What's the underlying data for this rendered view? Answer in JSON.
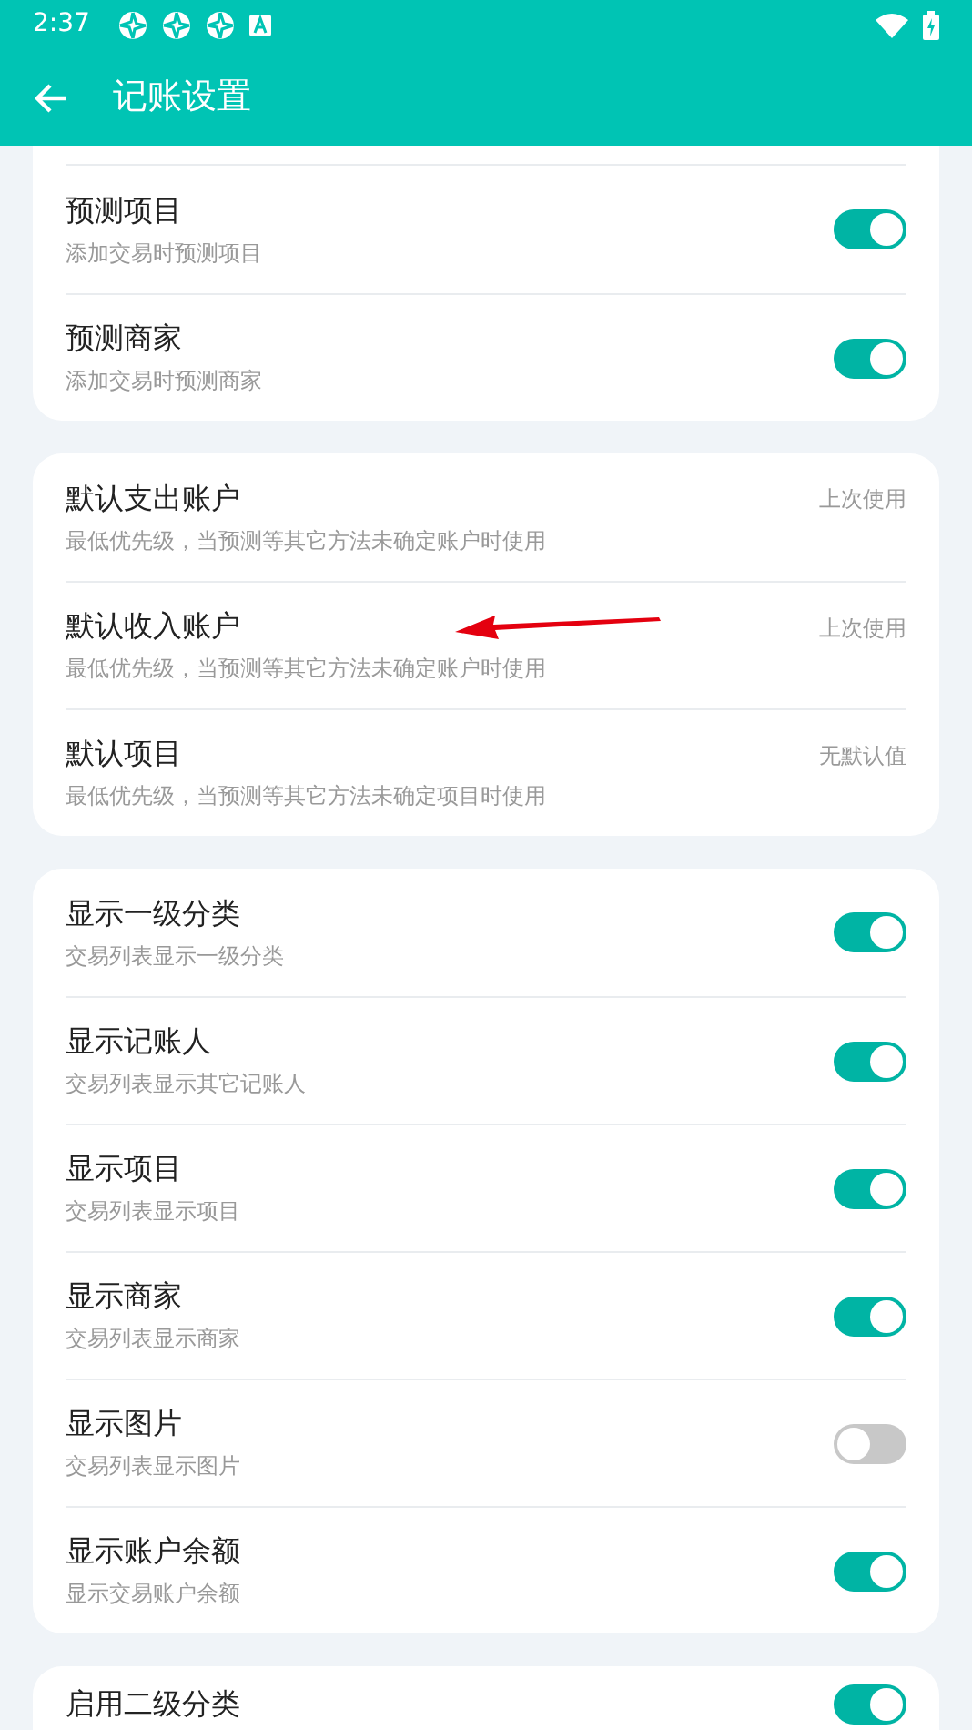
{
  "status_bar": {
    "time": "2:37"
  },
  "app_bar": {
    "title": "记账设置"
  },
  "sections": [
    {
      "cut_top": true,
      "items": [
        {
          "kind": "toggle",
          "title": "预测项目",
          "subtitle": "添加交易时预测项目",
          "on": true
        },
        {
          "kind": "toggle",
          "title": "预测商家",
          "subtitle": "添加交易时预测商家",
          "on": true
        }
      ]
    },
    {
      "cut_top": false,
      "items": [
        {
          "kind": "value",
          "title": "默认支出账户",
          "subtitle": "最低优先级，当预测等其它方法未确定账户时使用",
          "value": "上次使用"
        },
        {
          "kind": "value",
          "title": "默认收入账户",
          "subtitle": "最低优先级，当预测等其它方法未确定账户时使用",
          "value": "上次使用"
        },
        {
          "kind": "value",
          "title": "默认项目",
          "subtitle": "最低优先级，当预测等其它方法未确定项目时使用",
          "value": "无默认值"
        }
      ]
    },
    {
      "cut_top": false,
      "items": [
        {
          "kind": "toggle",
          "title": "显示一级分类",
          "subtitle": "交易列表显示一级分类",
          "on": true
        },
        {
          "kind": "toggle",
          "title": "显示记账人",
          "subtitle": "交易列表显示其它记账人",
          "on": true
        },
        {
          "kind": "toggle",
          "title": "显示项目",
          "subtitle": "交易列表显示项目",
          "on": true
        },
        {
          "kind": "toggle",
          "title": "显示商家",
          "subtitle": "交易列表显示商家",
          "on": true
        },
        {
          "kind": "toggle",
          "title": "显示图片",
          "subtitle": "交易列表显示图片",
          "on": false
        },
        {
          "kind": "toggle",
          "title": "显示账户余额",
          "subtitle": "显示交易账户余额",
          "on": true
        }
      ]
    },
    {
      "cut_top": false,
      "items": [
        {
          "kind": "toggle",
          "title": "启用二级分类",
          "on": true
        }
      ]
    }
  ]
}
